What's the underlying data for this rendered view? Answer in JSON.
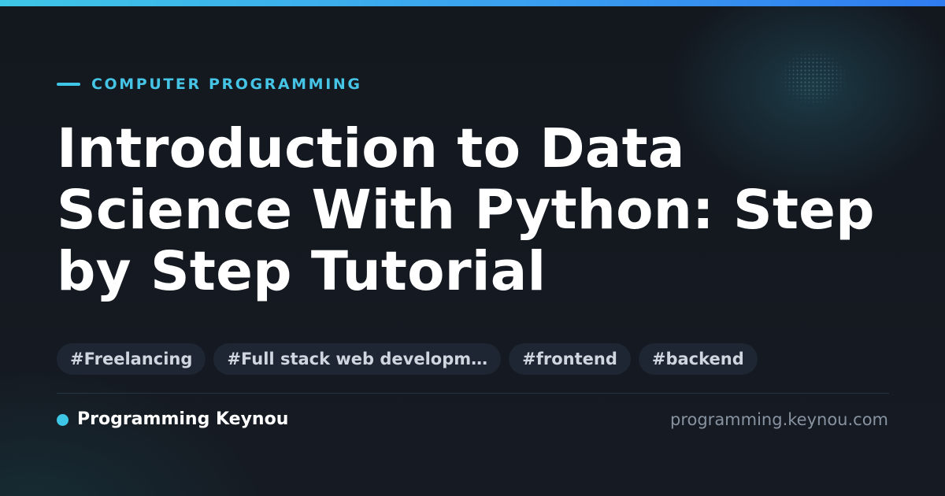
{
  "category": {
    "label": "COMPUTER PROGRAMMING"
  },
  "title": "Introduction to Data Science With Python: Step by Step Tutorial",
  "tags": [
    "#Freelancing",
    "#Full stack web developm…",
    "#frontend",
    "#backend"
  ],
  "footer": {
    "author": "Programming Keynou",
    "site_url": "programming.keynou.com"
  },
  "colors": {
    "accent": "#3ec6e6",
    "background": "#14181f",
    "title": "#ffffff",
    "tag_background": "#1d2632",
    "tag_text": "#d0d6df",
    "muted_text": "#8893a1"
  }
}
